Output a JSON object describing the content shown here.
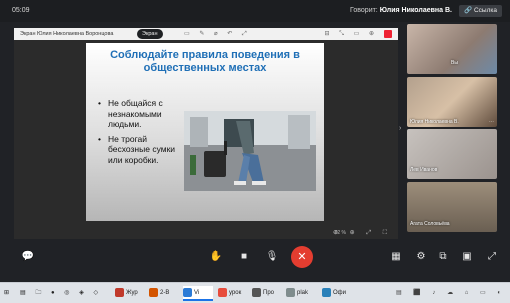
{
  "topbar": {
    "time": "05:09",
    "speaking_prefix": "Говорит:",
    "speaking_name": "Юлия Николаевна В.",
    "link_label": "Ссылка"
  },
  "share": {
    "presenter": "Экран Юлия Николаевна Воронцова",
    "badge": "Экран",
    "zoom": "82 %",
    "slide": {
      "title": "Соблюдайте правила поведения в общественных местах",
      "bullets": [
        "Не общайся с незнакомыми людьми.",
        "Не трогай бесхозные сумки или коробки."
      ]
    }
  },
  "participants": [
    {
      "name": "Вы"
    },
    {
      "name": "Юлия Николаевна В."
    },
    {
      "name": "Лев Иванов"
    },
    {
      "name": "Агата Соловьёва"
    }
  ],
  "taskbar": {
    "items": [
      {
        "label": "Жур",
        "color": "#c0392b"
      },
      {
        "label": "2-В",
        "color": "#d35400"
      },
      {
        "label": "Vi",
        "color": "#2b7bd6"
      },
      {
        "label": "урок",
        "color": "#e74c3c"
      },
      {
        "label": "Про",
        "color": "#555555"
      },
      {
        "label": "plak",
        "color": "#7f8c8d"
      },
      {
        "label": "Офи",
        "color": "#2980b9"
      }
    ]
  },
  "icons": [
    "chat-icon",
    "raise-hand-icon",
    "camera-icon",
    "mic-icon",
    "end-call-icon",
    "grid-icon",
    "settings-icon",
    "screen-share-icon",
    "fullscreen-icon"
  ],
  "colors": {
    "accent_blue": "#1f6fb6",
    "end_call": "#e43d30"
  }
}
